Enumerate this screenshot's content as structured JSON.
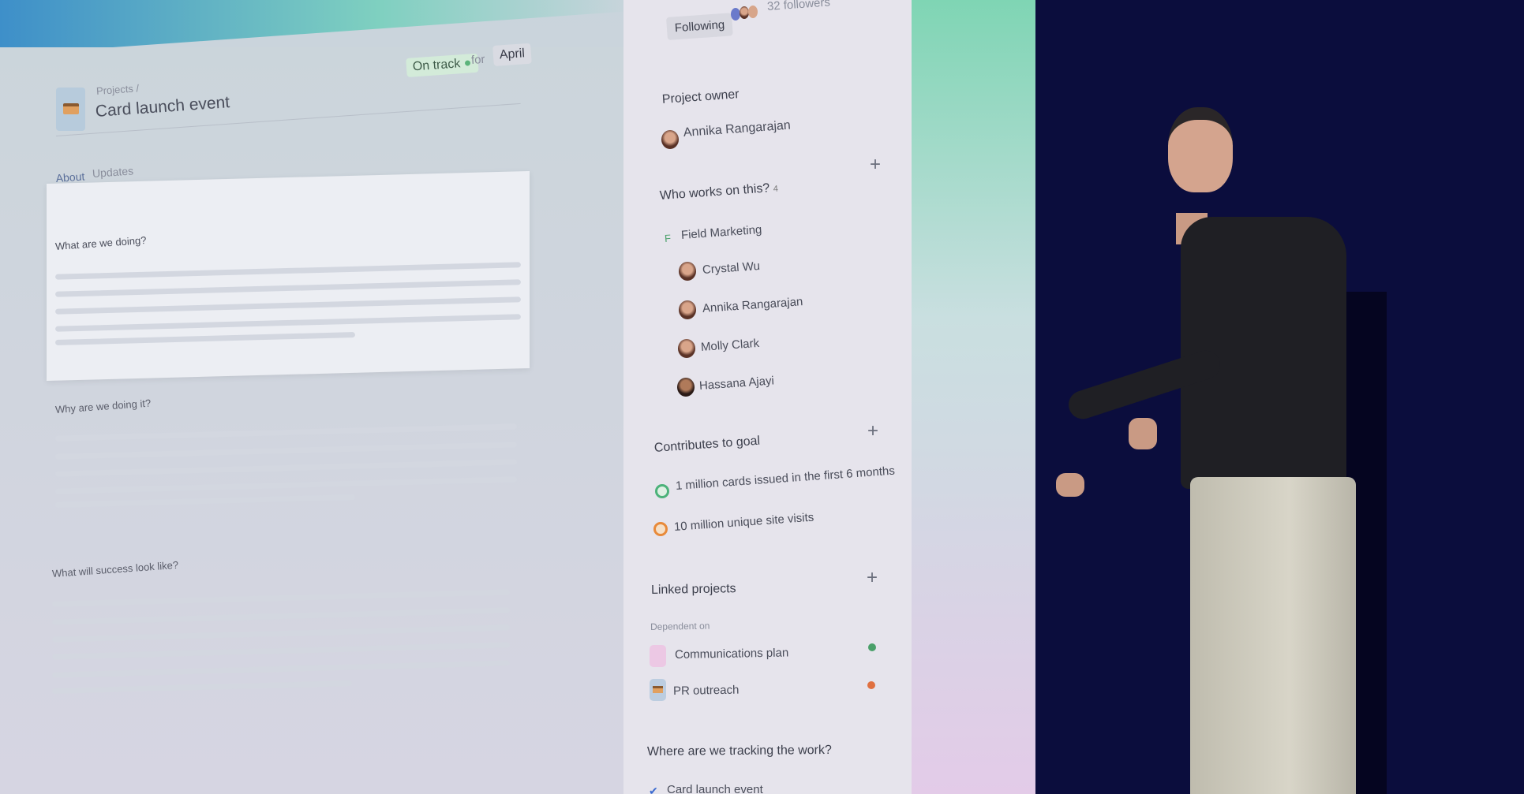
{
  "header": {
    "status": "On track",
    "status_color": "#5bb37a",
    "for_label": "for",
    "period": "April",
    "breadcrumb": "Projects /",
    "title": "Card launch event"
  },
  "tabs": [
    {
      "label": "About"
    },
    {
      "label": "Updates"
    }
  ],
  "sections": {
    "what": "What are we doing?",
    "why": "Why are we doing it?",
    "success": "What will success look like?"
  },
  "sidebar": {
    "following": "Following",
    "followers": "32 followers",
    "owner_heading": "Project owner",
    "owner": "Annika Rangarajan",
    "who_heading": "Who works on this?",
    "who_count": "4",
    "team_initial": "F",
    "team": "Field Marketing",
    "members": [
      "Crystal Wu",
      "Annika Rangarajan",
      "Molly Clark",
      "Hassana Ajayi"
    ],
    "goal_heading": "Contributes to goal",
    "goals": [
      {
        "label": "1 million cards issued in the first 6 months",
        "color": "#4cb27a"
      },
      {
        "label": "10 million unique site visits",
        "color": "#e88a3a"
      }
    ],
    "linked_heading": "Linked projects",
    "dependent_label": "Dependent on",
    "linked": [
      {
        "label": "Communications plan",
        "status_color": "#4aa06a"
      },
      {
        "label": "PR outreach",
        "status_color": "#e07040"
      }
    ],
    "tracking_heading": "Where are we tracking the work?",
    "tracking_item": "Card launch event"
  },
  "colors": {
    "stage_background": "#0b0d3d"
  }
}
